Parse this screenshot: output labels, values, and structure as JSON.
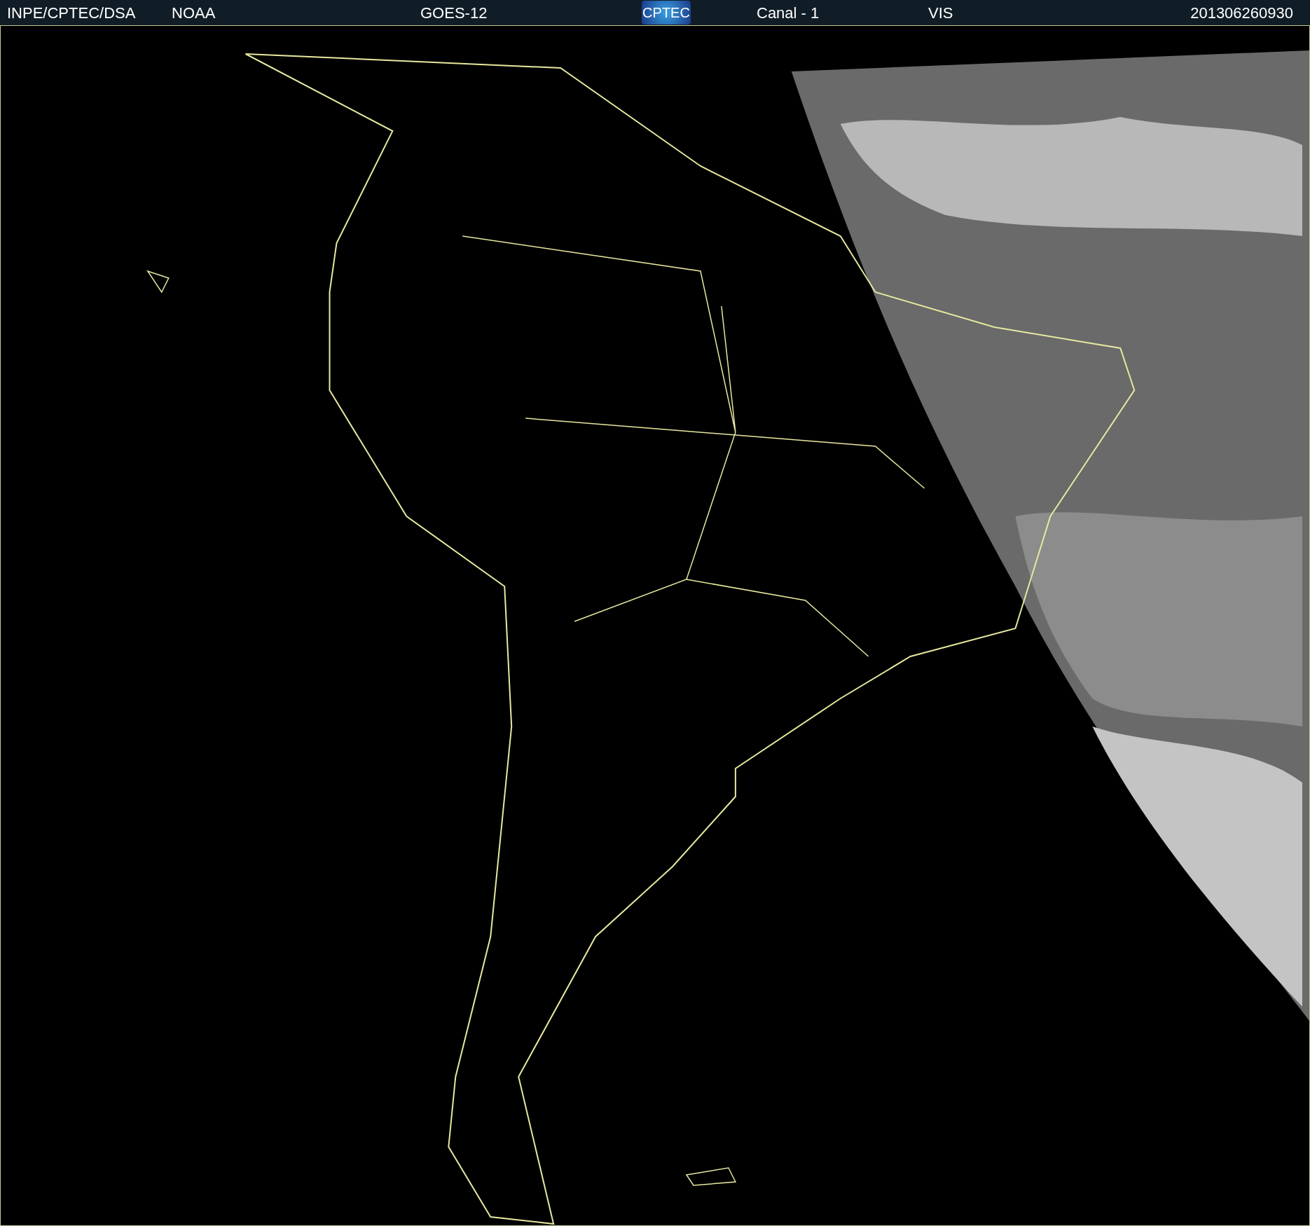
{
  "header": {
    "items": [
      {
        "kind": "text",
        "text": "INPE/CPTEC/DSA"
      },
      {
        "kind": "text",
        "text": "NOAA"
      },
      {
        "kind": "text",
        "text": "GOES-12"
      },
      {
        "kind": "logo",
        "text": "CPTEC"
      },
      {
        "kind": "text",
        "text": "Canal - 1"
      },
      {
        "kind": "text",
        "text": "VIS"
      },
      {
        "kind": "text",
        "text": "201306260930"
      }
    ]
  }
}
